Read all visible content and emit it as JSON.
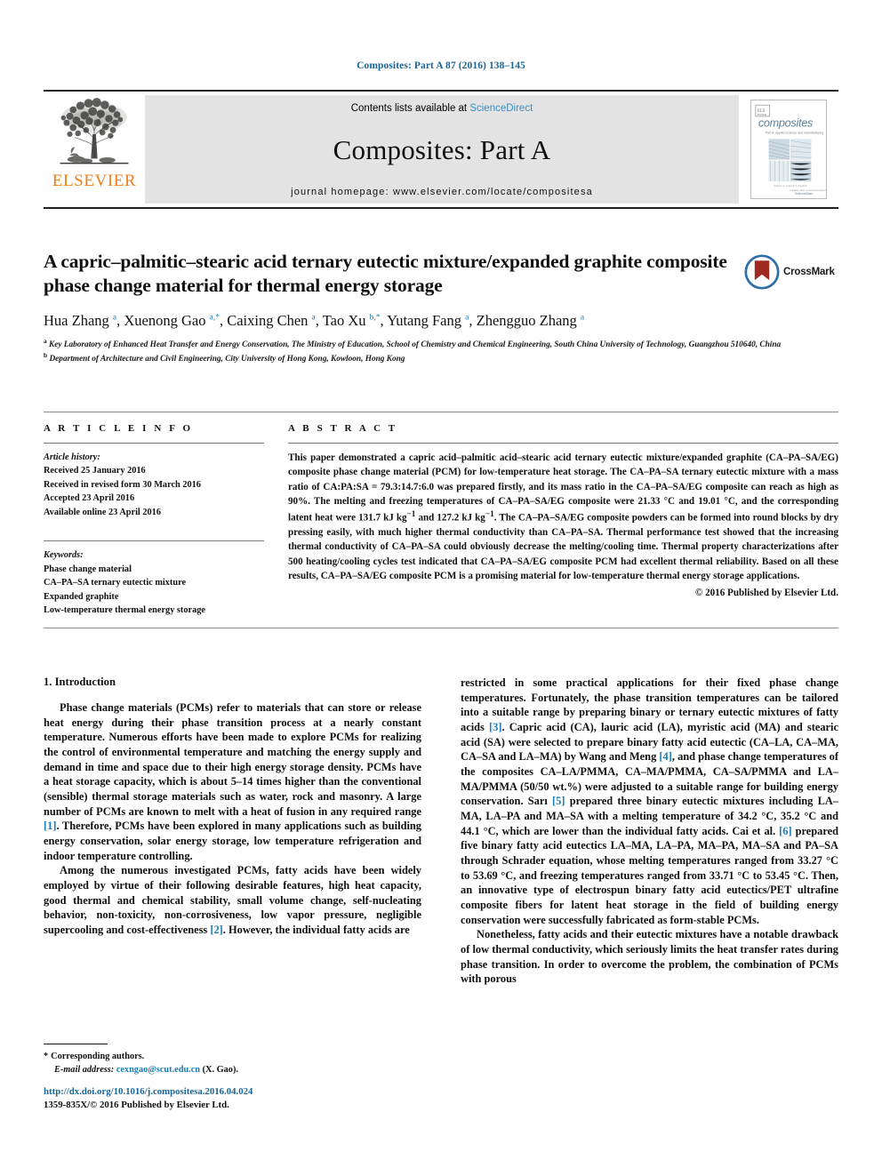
{
  "running_head": "Composites: Part A 87 (2016) 138–145",
  "masthead": {
    "publisher_name": "ELSEVIER",
    "contents_prefix": "Contents lists available at ",
    "contents_link": "ScienceDirect",
    "journal_title": "Composites: Part A",
    "homepage": "journal homepage: www.elsevier.com/locate/compositesa",
    "cover": {
      "wordmark": "composites",
      "subtitle": "Part A: applied science and manufacturing",
      "footer_left": "Editors: I.A. Ashcroft, K. Friedrich",
      "footer_right": "Available online at www.sciencedirect.com",
      "footer_brand": "ScienceDirect"
    }
  },
  "article": {
    "title": "A capric–palmitic–stearic acid ternary eutectic mixture/expanded graphite composite phase change material for thermal energy storage",
    "crossmark_label": "CrossMark",
    "authors_html": "Hua Zhang <sup>a</sup>, Xuenong Gao <sup>a,*</sup>, Caixing Chen <sup>a</sup>, Tao Xu <sup>b,*</sup>, Yutang Fang <sup>a</sup>, Zhengguo Zhang <sup>a</sup>",
    "affiliation_a": "Key Laboratory of Enhanced Heat Transfer and Energy Conservation, The Ministry of Education, School of Chemistry and Chemical Engineering, South China University of Technology, Guangzhou 510640, China",
    "affiliation_b": "Department of Architecture and Civil Engineering, City University of Hong Kong, Kowloon, Hong Kong"
  },
  "article_info": {
    "heading": "A R T I C L E     I N F O",
    "history_label": "Article history:",
    "history": [
      "Received 25 January 2016",
      "Received in revised form 30 March 2016",
      "Accepted 23 April 2016",
      "Available online 23 April 2016"
    ],
    "keywords_label": "Keywords:",
    "keywords": [
      "Phase change material",
      "CA–PA–SA ternary eutectic mixture",
      "Expanded graphite",
      "Low-temperature thermal energy storage"
    ]
  },
  "abstract": {
    "heading": "A B S T R A C T",
    "text": "This paper demonstrated a capric acid–palmitic acid–stearic acid ternary eutectic mixture/expanded graphite (CA–PA–SA/EG) composite phase change material (PCM) for low-temperature heat storage. The CA–PA–SA ternary eutectic mixture with a mass ratio of CA:PA:SA = 79.3:14.7:6.0 was prepared firstly, and its mass ratio in the CA–PA–SA/EG composite can reach as high as 90%. The melting and freezing temperatures of CA–PA–SA/EG composite were 21.33 °C and 19.01 °C, and the corresponding latent heat were 131.7 kJ kg−1 and 127.2 kJ kg−1. The CA–PA–SA/EG composite powders can be formed into round blocks by dry pressing easily, with much higher thermal conductivity than CA–PA–SA. Thermal performance test showed that the increasing thermal conductivity of CA–PA–SA could obviously decrease the melting/cooling time. Thermal property characterizations after 500 heating/cooling cycles test indicated that CA–PA–SA/EG composite PCM had excellent thermal reliability. Based on all these results, CA–PA–SA/EG composite PCM is a promising material for low-temperature thermal energy storage applications.",
    "copyright": "© 2016 Published by Elsevier Ltd."
  },
  "body": {
    "section_heading": "1. Introduction",
    "left_paragraphs": [
      "Phase change materials (PCMs) refer to materials that can store or release heat energy during their phase transition process at a nearly constant temperature. Numerous efforts have been made to explore PCMs for realizing the control of environmental temperature and matching the energy supply and demand in time and space due to their high energy storage density. PCMs have a heat storage capacity, which is about 5–14 times higher than the conventional (sensible) thermal storage materials such as water, rock and masonry. A large number of PCMs are known to melt with a heat of fusion in any required range [1]. Therefore, PCMs have been explored in many applications such as building energy conservation, solar energy storage, low temperature refrigeration and indoor temperature controlling.",
      "Among the numerous investigated PCMs, fatty acids have been widely employed by virtue of their following desirable features, high heat capacity, good thermal and chemical stability, small volume change, self-nucleating behavior, non-toxicity, non-corrosiveness, low vapor pressure, negligible supercooling and cost-effectiveness [2]. However, the individual fatty acids are"
    ],
    "right_paragraphs": [
      "restricted in some practical applications for their fixed phase change temperatures. Fortunately, the phase transition temperatures can be tailored into a suitable range by preparing binary or ternary eutectic mixtures of fatty acids [3]. Capric acid (CA), lauric acid (LA), myristic acid (MA) and stearic acid (SA) were selected to prepare binary fatty acid eutectic (CA–LA, CA–MA, CA–SA and LA–MA) by Wang and Meng [4], and phase change temperatures of the composites CA–LA/PMMA, CA–MA/PMMA, CA–SA/PMMA and LA–MA/PMMA (50/50 wt.%) were adjusted to a suitable range for building energy conservation. Sarı [5] prepared three binary eutectic mixtures including LA–MA, LA–PA and MA–SA with a melting temperature of 34.2 °C, 35.2 °C and 44.1 °C, which are lower than the individual fatty acids. Cai et al. [6] prepared five binary fatty acid eutectics LA–MA, LA–PA, MA–PA, MA–SA and PA–SA through Schrader equation, whose melting temperatures ranged from 33.27 °C to 53.69 °C, and freezing temperatures ranged from 33.71 °C to 53.45 °C. Then, an innovative type of electrospun binary fatty acid eutectics/PET ultrafine composite fibers for latent heat storage in the field of building energy conservation were successfully fabricated as form-stable PCMs.",
      "Nonetheless, fatty acids and their eutectic mixtures have a notable drawback of low thermal conductivity, which seriously limits the heat transfer rates during phase transition. In order to overcome the problem, the combination of PCMs with porous"
    ]
  },
  "footnotes": {
    "corresponding": "Corresponding authors.",
    "corresponding_star": "*",
    "email_label": "E-mail address:",
    "email": "cexngao@scut.edu.cn",
    "email_suffix": "(X. Gao)."
  },
  "footer": {
    "doi": "http://dx.doi.org/10.1016/j.compositesa.2016.04.024",
    "issn": "1359-835X/© 2016 Published by Elsevier Ltd."
  },
  "colors": {
    "link_blue": "#1a7cb5",
    "running_head_blue": "#1a6496",
    "elsevier_orange": "#f07f1a",
    "masthead_grey": "#e3e3e3"
  }
}
